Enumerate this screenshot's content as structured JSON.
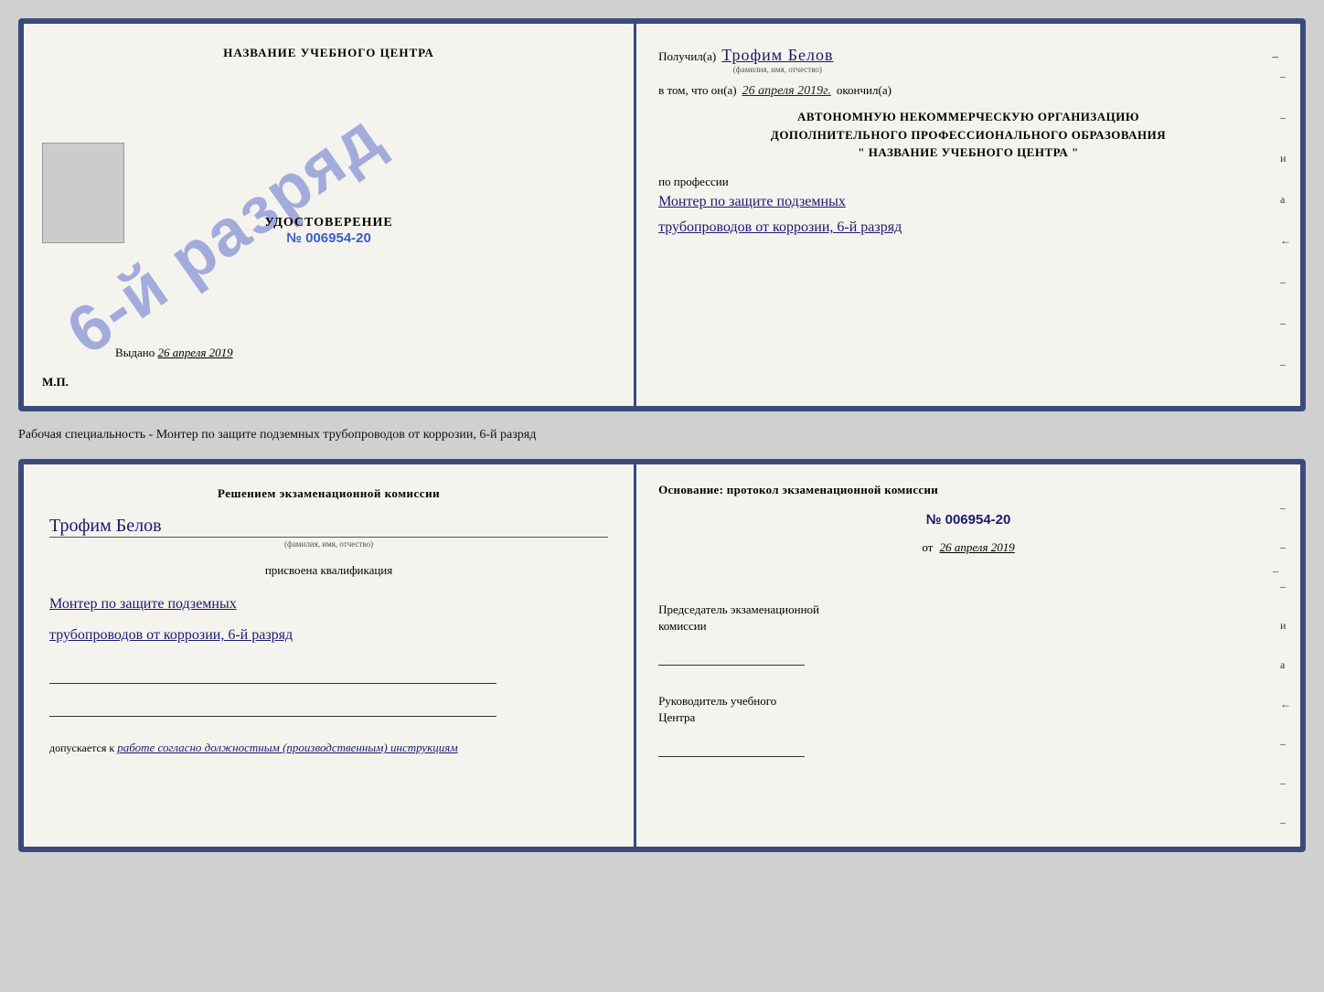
{
  "top_doc": {
    "left": {
      "center_title": "НАЗВАНИЕ УЧЕБНОГО ЦЕНТРА",
      "stamp_line1": "6-й",
      "stamp_line2": "разряд",
      "udostoverenie_title": "УДОСТОВЕРЕНИЕ",
      "udostoverenie_number": "№ 006954-20",
      "vydano_label": "Выдано",
      "vydano_date": "26 апреля 2019",
      "mp_label": "М.П."
    },
    "right": {
      "poluchil_label": "Получил(a)",
      "poluchil_name": "Трофим Белов",
      "fio_label": "(фамилия, имя, отчество)",
      "dash1": "–",
      "vtom_label": "в том, что он(а)",
      "vtom_date": "26 апреля 2019г.",
      "okonchil_label": "окончил(а)",
      "org_line1": "АВТОНОМНУЮ НЕКОММЕРЧЕСКУЮ ОРГАНИЗАЦИЮ",
      "org_line2": "ДОПОЛНИТЕЛЬНОГО ПРОФЕССИОНАЛЬНОГО ОБРАЗОВАНИЯ",
      "org_line3": "\" НАЗВАНИЕ УЧЕБНОГО ЦЕНТРА \"",
      "po_professii_label": "по профессии",
      "profession_line1": "Монтер по защите подземных",
      "profession_line2": "трубопроводов от коррозии, 6-й разряд",
      "right_chars": [
        "–",
        "–",
        "и",
        "а",
        "←",
        "–",
        "–",
        "–",
        "–"
      ]
    }
  },
  "middle_text": "Рабочая специальность - Монтер по защите подземных трубопроводов от коррозии, 6-й разряд",
  "bottom_doc": {
    "left": {
      "resheniem_label": "Решением экзаменационной комиссии",
      "person_name": "Трофим Белов",
      "fio_label": "(фамилия, имя, отчество)",
      "prisvoyena_label": "присвоена квалификация",
      "profession_line1": "Монтер по защите подземных",
      "profession_line2": "трубопроводов от коррозии, 6-й разряд",
      "dopuskaetsya_label": "допускается к",
      "dopuskaetsya_text": "работе согласно должностным (производственным) инструкциям"
    },
    "right": {
      "osnovanie_label": "Основание: протокол экзаменационной комиссии",
      "number_label": "№ 006954-20",
      "ot_label": "от",
      "ot_date": "26 апреля 2019",
      "predsedatel_line1": "Председатель экзаменационной",
      "predsedatel_line2": "комиссии",
      "rukovoditel_line1": "Руководитель учебного",
      "rukovoditel_line2": "Центра",
      "right_chars": [
        "–",
        "–",
        "–",
        "и",
        "а",
        "←",
        "–",
        "–",
        "–",
        "–"
      ]
    }
  }
}
